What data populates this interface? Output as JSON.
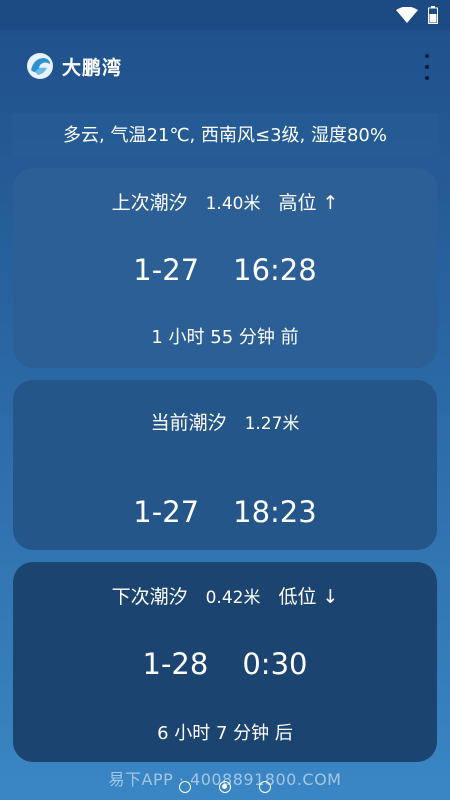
{
  "app": {
    "title": "大鹏湾",
    "logo_icon": "wave-logo-icon"
  },
  "weather": {
    "text": "多云, 气温21℃, 西南风≤3级, 湿度80%"
  },
  "cards": {
    "previous": {
      "label": "上次潮汐",
      "height": "1.40米",
      "level": "高位 ↑",
      "date": "1-27",
      "time": "16:28",
      "relative": "1 小时 55 分钟 前"
    },
    "current": {
      "label": "当前潮汐",
      "height": "1.27米",
      "date": "1-27",
      "time": "18:23"
    },
    "next": {
      "label": "下次潮汐",
      "height": "0.42米",
      "level": "低位 ↓",
      "date": "1-28",
      "time": "0:30",
      "relative": "6 小时 7 分钟 后"
    }
  },
  "watermark": "易下APP · 4008891800.COM",
  "pagination": {
    "count": 3,
    "active": 2
  },
  "colors": {
    "background_top": "#1f4f8a",
    "background_bottom": "#3a86c4",
    "card": "#2b5f96"
  }
}
